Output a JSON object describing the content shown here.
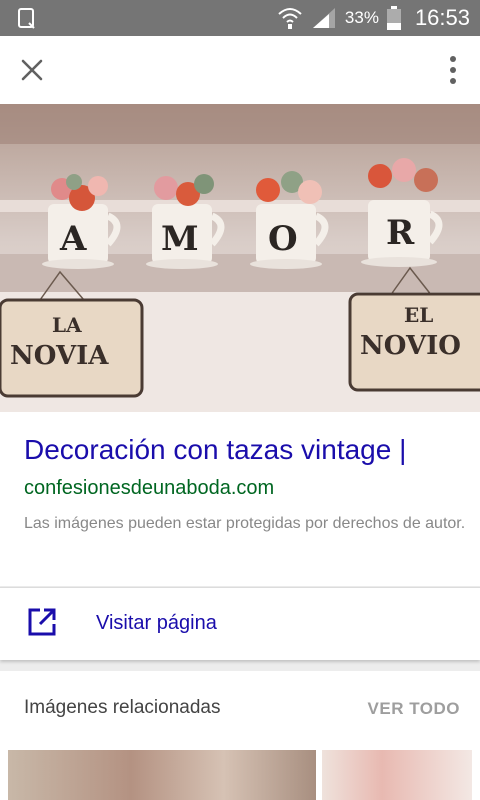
{
  "status_bar": {
    "battery_percent": "33%",
    "time": "16:53"
  },
  "result": {
    "title": "Decoración con tazas vintage |",
    "domain": "confesionesdeunaboda.com",
    "notice": "Las imágenes pueden estar protegidas por derechos de autor."
  },
  "image_text": {
    "cup_letters": [
      "A",
      "M",
      "O",
      "R"
    ],
    "sign_left": {
      "line1": "LA",
      "line2": "NOVIA"
    },
    "sign_right": {
      "line1": "EL",
      "line2": "NOVIO"
    }
  },
  "visit": {
    "label": "Visitar página"
  },
  "related": {
    "title": "Imágenes relacionadas",
    "view_all": "VER TODO"
  },
  "colors": {
    "title_blue": "#1a0dab",
    "domain_green": "#006621",
    "status_bar": "#757575"
  },
  "icons": [
    "screenshot-notification-icon",
    "wifi-icon",
    "signal-icon",
    "battery-icon",
    "close-icon",
    "more-vert-icon",
    "open-in-new-icon"
  ]
}
